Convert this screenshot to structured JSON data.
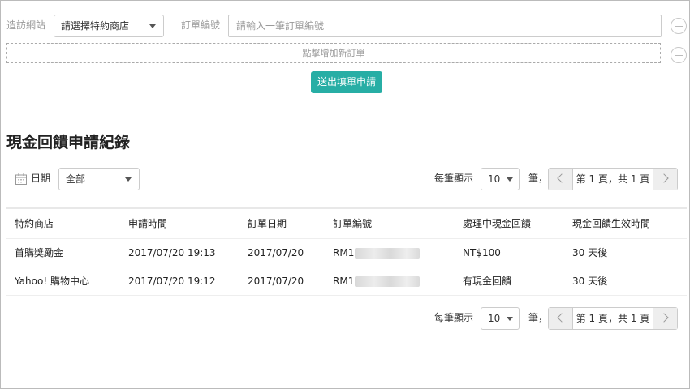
{
  "form": {
    "site_label": "造訪網站",
    "store_select": "請選擇特約商店",
    "order_label": "訂單編號",
    "order_placeholder": "請輸入一筆訂單編號",
    "add_order": "點擊增加新訂單",
    "submit": "送出填單申請"
  },
  "records": {
    "title": "現金回饋申請紀錄",
    "date_label": "日期",
    "date_filter": "全部",
    "per_page_label": "每筆顯示",
    "per_page_value": "10",
    "per_page_unit": "筆，",
    "page_info": "第 1 頁，共 1 頁"
  },
  "table": {
    "headers": [
      "特約商店",
      "申請時間",
      "訂單日期",
      "訂單編號",
      "處理中現金回饋",
      "現金回饋生效時間"
    ],
    "rows": [
      [
        "首購獎勵金",
        "2017/07/20 19:13",
        "2017/07/20",
        "RM1",
        "NT$100",
        "30 天後"
      ],
      [
        "Yahoo! 購物中心",
        "2017/07/20 19:12",
        "2017/07/20",
        "RM1",
        "有現金回饋",
        "30 天後"
      ]
    ]
  },
  "colors": {
    "accent": "#27aea5"
  }
}
